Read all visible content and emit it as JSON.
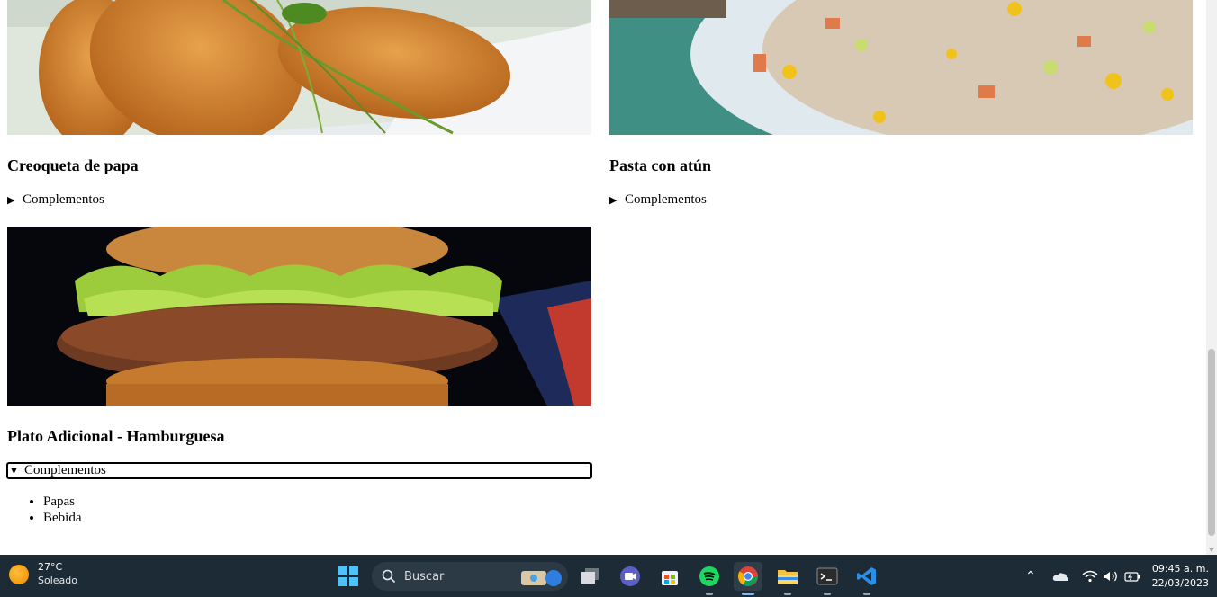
{
  "cards": [
    {
      "title": "Creoqueta de papa",
      "summary": "Complementos",
      "open": false,
      "image_icon": "croquette-photo"
    },
    {
      "title": "Pasta con atún",
      "summary": "Complementos",
      "open": false,
      "image_icon": "pasta-salad-photo"
    },
    {
      "title": "Plato Adicional - Hamburguesa",
      "summary": "Complementos",
      "open": true,
      "items": [
        "Papas",
        "Bebida"
      ],
      "image_icon": "hamburger-photo"
    }
  ],
  "taskbar": {
    "weather": {
      "temp": "27°C",
      "condition": "Soleado",
      "icon": "sun-icon"
    },
    "search_label": "Buscar",
    "apps": [
      "start-icon",
      "search-icon",
      "task-view-icon",
      "teams-icon",
      "store-icon",
      "spotify-icon",
      "chrome-icon",
      "file-explorer-icon",
      "terminal-icon",
      "vscode-icon"
    ],
    "clock": {
      "time": "09:45 a. m.",
      "date": "22/03/2023"
    }
  },
  "colors": {
    "taskbar_bg": "#1c2b36",
    "spotify": "#1ed760",
    "vscode": "#2b8fe6"
  }
}
